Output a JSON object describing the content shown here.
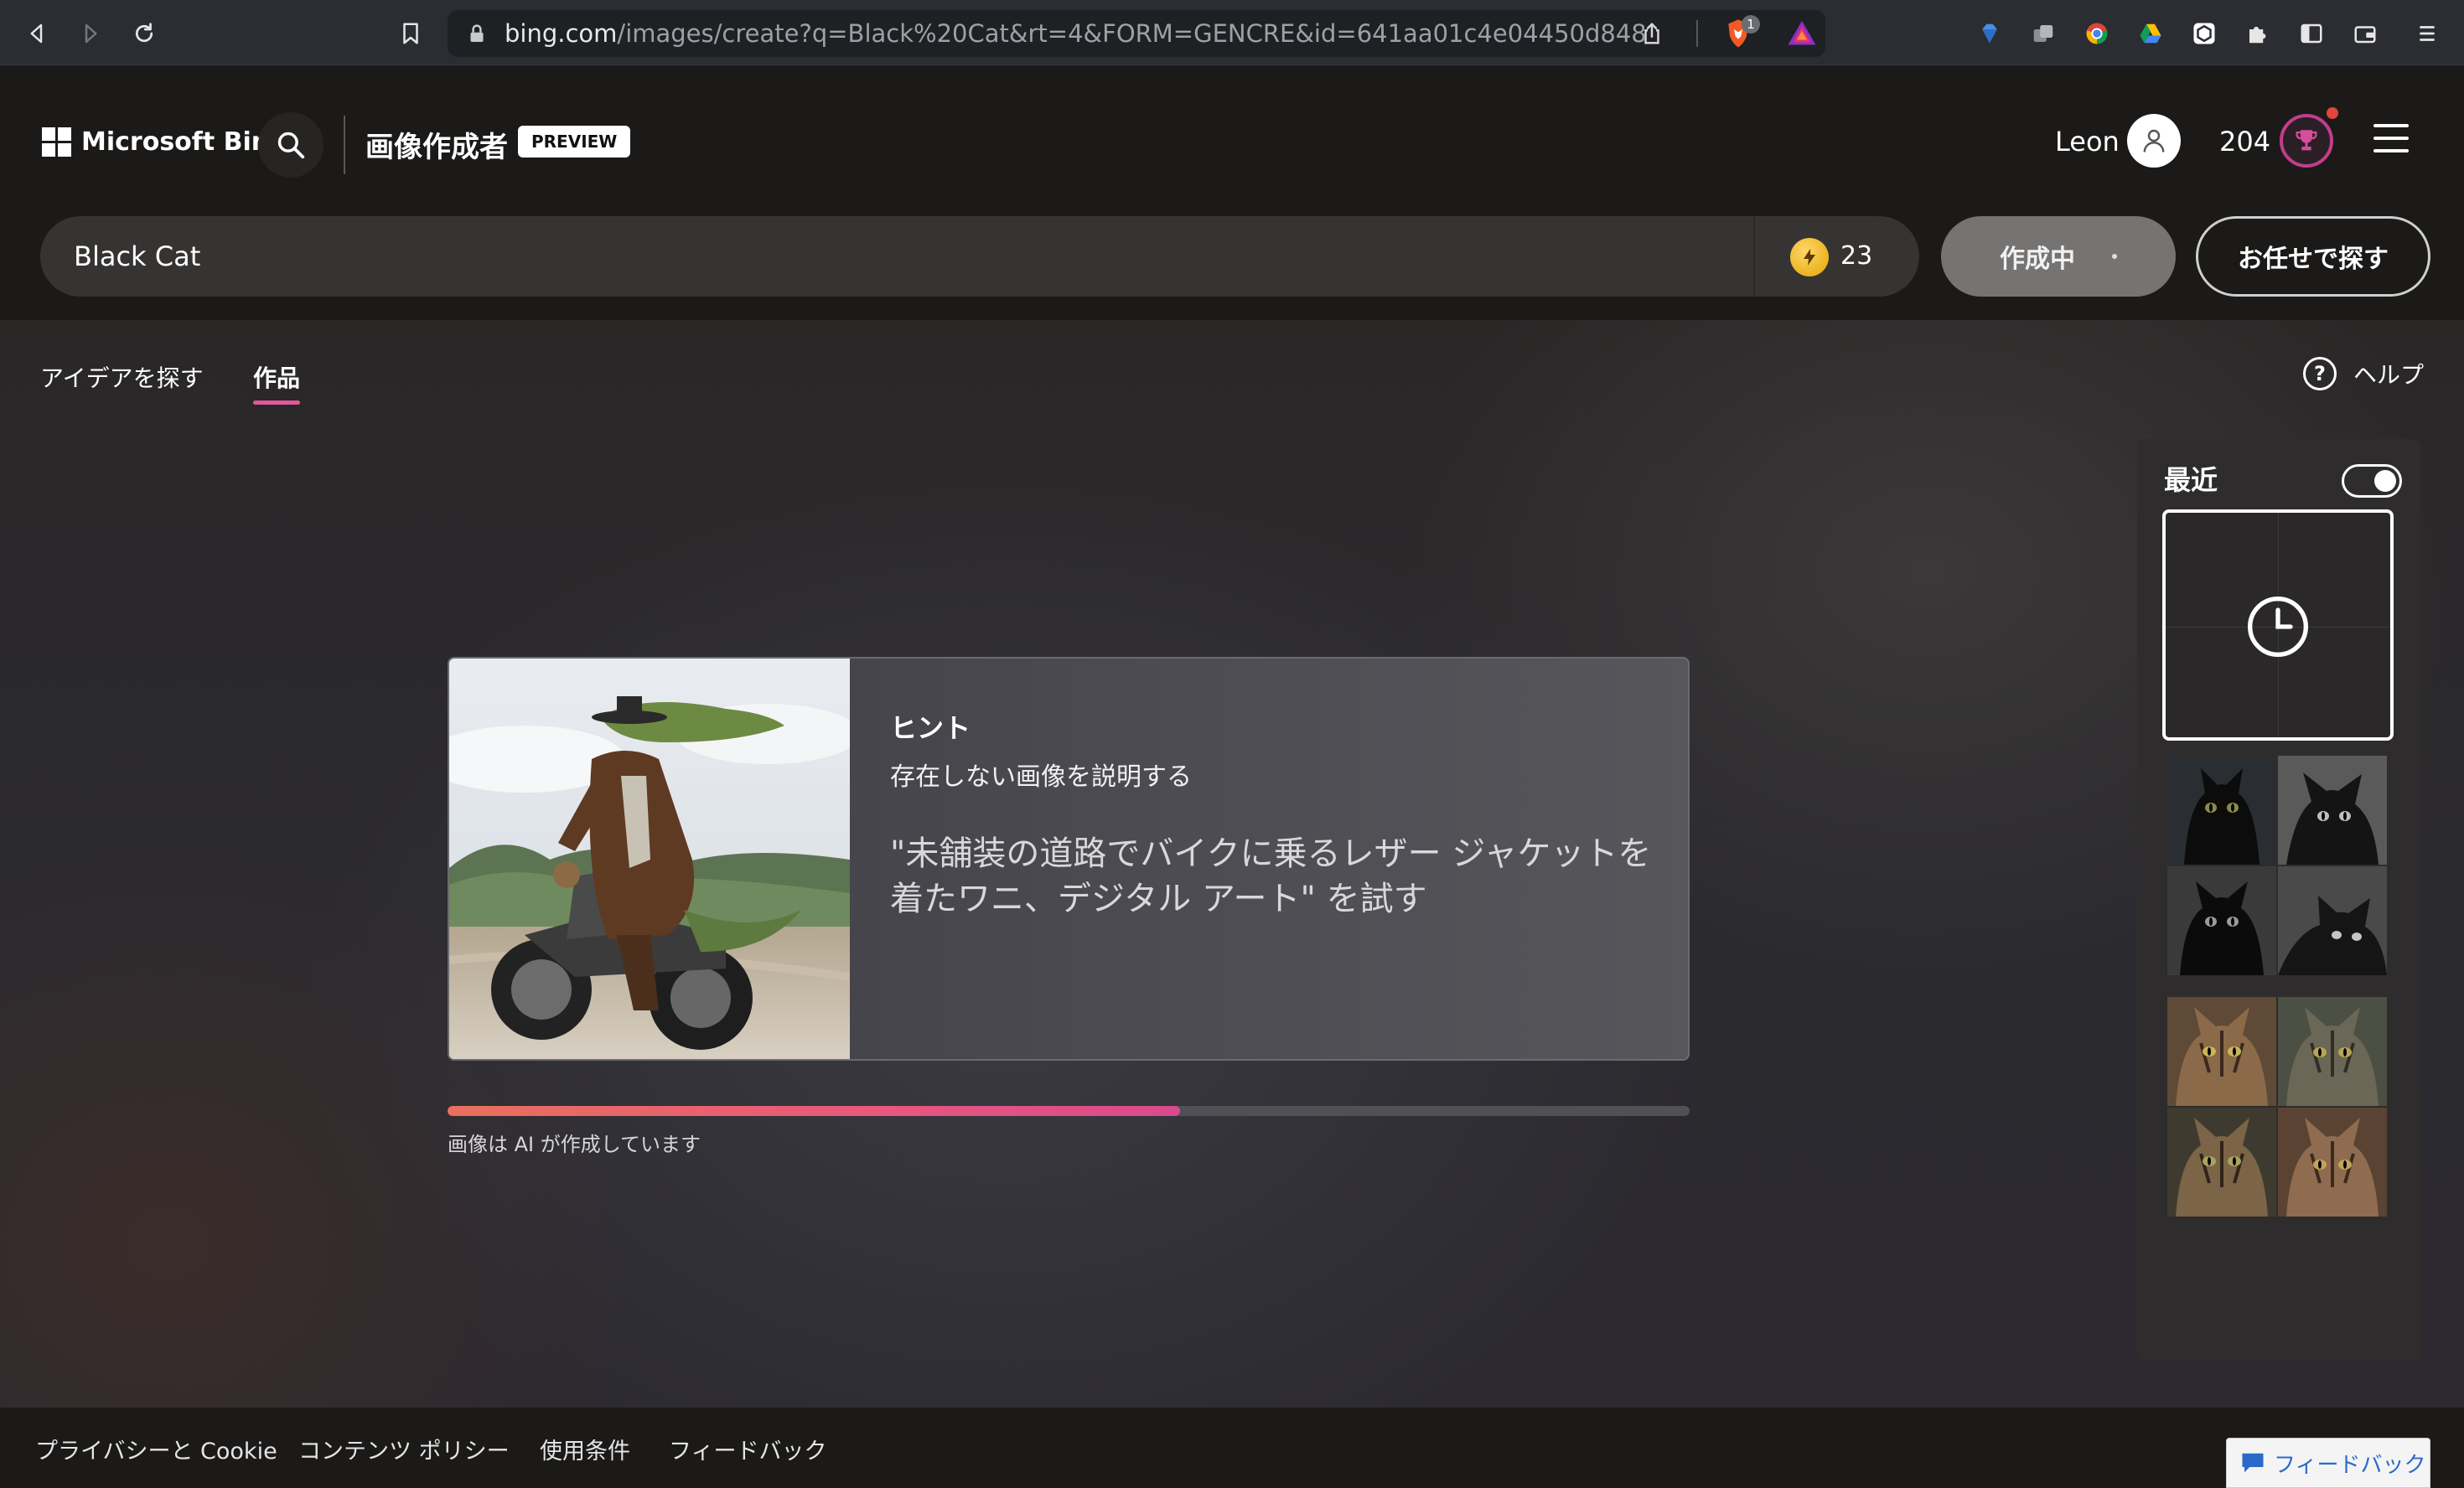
{
  "browser": {
    "url_host": "bing.com",
    "url_rest": "/images/create?q=Black%20Cat&rt=4&FORM=GENCRE&id=641aa01c4e04450d8486206e...",
    "extension_badge": "1"
  },
  "header": {
    "brand": "Microsoft Bing",
    "app_title": "画像作成者",
    "preview_badge": "PREVIEW",
    "user_name": "Leon",
    "points": "204"
  },
  "prompt": {
    "value": "Black Cat",
    "boosts": "23",
    "create_label": "作成中",
    "surprise_label": "お任せで探す"
  },
  "tabs": [
    {
      "label": "アイデアを探す",
      "active": false
    },
    {
      "label": "作品",
      "active": true
    }
  ],
  "help": {
    "label": "ヘルプ"
  },
  "hint": {
    "title": "ヒント",
    "subtitle": "存在しない画像を説明する",
    "example": "\"未舗装の道路でバイクに乗るレザー ジャケットを着たワニ、デジタル アート\" を試す"
  },
  "progress": {
    "fraction": 0.59,
    "label": "画像は AI が作成しています"
  },
  "recent": {
    "title": "最近",
    "toggle_on": true
  },
  "footer": {
    "links": [
      "プライバシーと Cookie",
      "コンテンツ ポリシー",
      "使用条件",
      "フィードバック"
    ],
    "feedback_button": "フィードバック"
  },
  "colors": {
    "accent_pink": "#e0579a",
    "progress_start": "#e8705c",
    "progress_end": "#d94a8c",
    "boost_gold": "#e2a400"
  }
}
